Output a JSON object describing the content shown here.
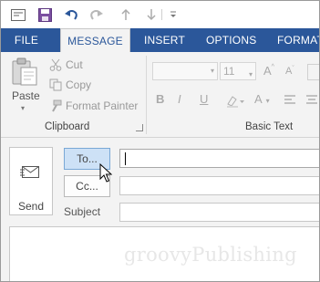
{
  "colors": {
    "accent": "#2b579a",
    "ribbon_bg": "#f3f3f3",
    "to_button_highlight": "#cde1f6",
    "disabled_text": "#aaaaaa"
  },
  "qat": {
    "icons": [
      "window-menu-icon",
      "save-icon",
      "undo-icon",
      "redo-icon",
      "up-arrow-icon",
      "down-arrow-icon",
      "customize-qat-icon"
    ]
  },
  "tabs": {
    "file": "FILE",
    "message": "MESSAGE",
    "insert": "INSERT",
    "options": "OPTIONS",
    "format": "FORMAT"
  },
  "active_tab": "MESSAGE",
  "clipboard": {
    "paste": "Paste",
    "cut": "Cut",
    "copy": "Copy",
    "format_painter": "Format Painter",
    "group_label": "Clipboard"
  },
  "basic_text": {
    "font_name": "",
    "font_size": "11",
    "grow_font": "A",
    "shrink_font": "A",
    "bold": "B",
    "italic": "I",
    "underline": "U",
    "font_color": "A",
    "group_label": "Basic Text"
  },
  "compose": {
    "send": "Send",
    "to": "To...",
    "cc": "Cc...",
    "subject_label": "Subject",
    "to_value": "",
    "cc_value": "",
    "subject_value": ""
  },
  "watermark": "groovyPublishing"
}
